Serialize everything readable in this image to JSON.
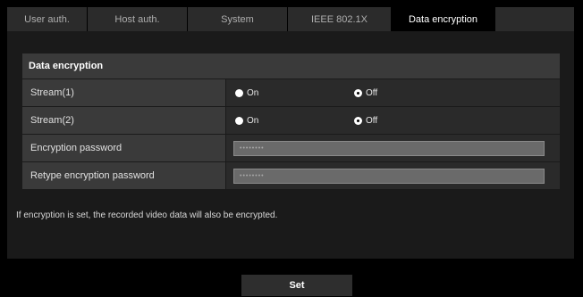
{
  "tabs": [
    "User auth.",
    "Host auth.",
    "System",
    "IEEE 802.1X",
    "Data encryption"
  ],
  "section": {
    "title": "Data encryption"
  },
  "rows": {
    "stream1": {
      "label": "Stream(1)",
      "on": "On",
      "off": "Off",
      "selected": "Off"
    },
    "stream2": {
      "label": "Stream(2)",
      "on": "On",
      "off": "Off",
      "selected": "Off"
    },
    "password": {
      "label": "Encryption password",
      "value": "••••••••"
    },
    "retype": {
      "label": "Retype encryption password",
      "value": "••••••••"
    }
  },
  "note": "If encryption is set, the recorded video data will also be encrypted.",
  "set_button": "Set"
}
